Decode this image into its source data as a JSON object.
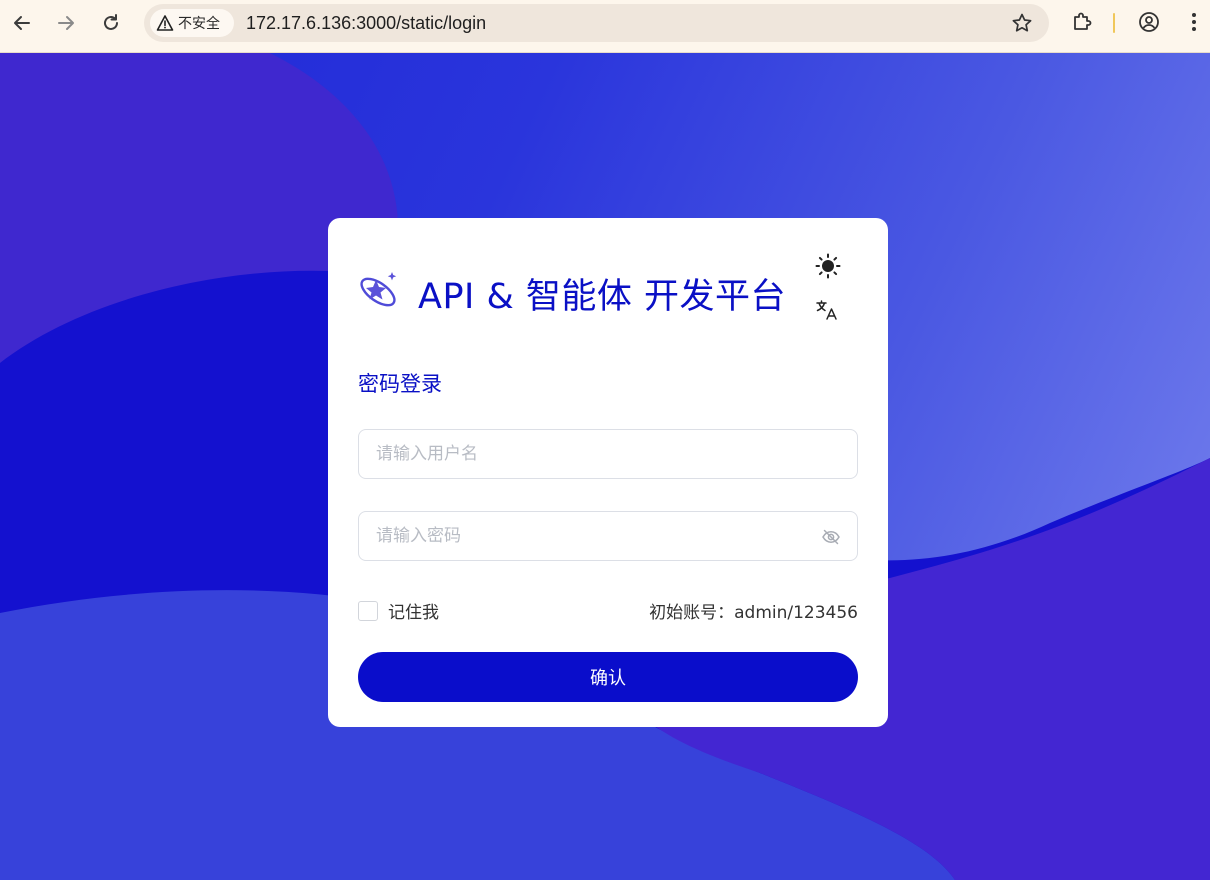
{
  "browser": {
    "security_label": "不安全",
    "url": "172.17.6.136:3000/static/login"
  },
  "login": {
    "app_title": "API & 智能体 开发平台",
    "section_title": "密码登录",
    "username_placeholder": "请输入用户名",
    "password_placeholder": "请输入密码",
    "remember_label": "记住我",
    "initial_account": "初始账号：admin/123456",
    "confirm_label": "确认"
  },
  "icons": {
    "logo": "planet-star-logo-icon",
    "theme": "sun-icon",
    "language": "translate-icon",
    "password_visibility": "eye-off-icon"
  },
  "colors": {
    "brand": "#0a10c5",
    "button": "#0a0dcb",
    "background_dark": "#1f27d6",
    "background_light": "#7b86ef"
  }
}
